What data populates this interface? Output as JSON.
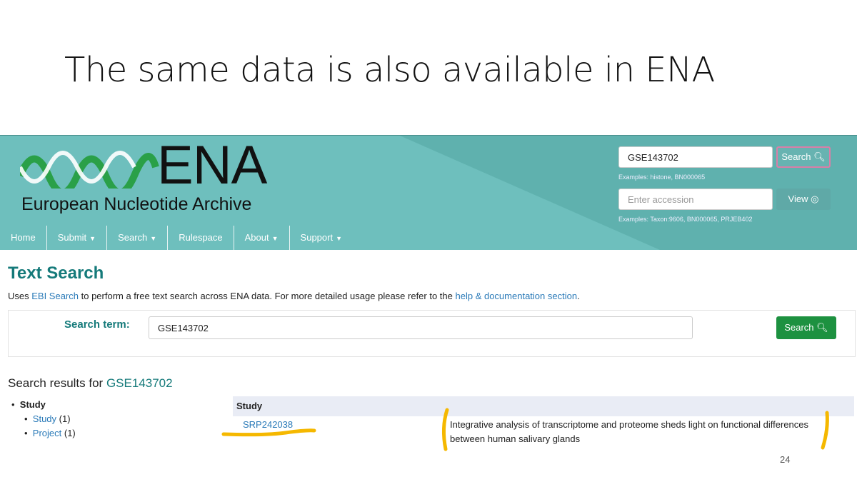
{
  "slide": {
    "title": "The same data is also available in ENA",
    "page_number": "24"
  },
  "header": {
    "logo_text": "ENA",
    "logo_subtitle": "European Nucleotide Archive",
    "search": {
      "value": "GSE143702",
      "button": "Search",
      "hint": "Examples: histone, BN000065"
    },
    "accession": {
      "placeholder": "Enter accession",
      "button": "View",
      "hint": "Examples: Taxon:9606, BN000065, PRJEB402"
    }
  },
  "nav": {
    "items": [
      {
        "label": "Home"
      },
      {
        "label": "Submit"
      },
      {
        "label": "Search"
      },
      {
        "label": "Rulespace"
      },
      {
        "label": "About"
      },
      {
        "label": "Support"
      }
    ]
  },
  "main": {
    "title": "Text Search",
    "uses_prefix": "Uses ",
    "uses_link": "EBI Search",
    "uses_middle": " to perform a free text search across ENA data. For more detailed usage please refer to the ",
    "uses_link2": "help & documentation section",
    "uses_suffix": ".",
    "search_label": "Search term:",
    "search_value": "GSE143702",
    "search_button": "Search",
    "results_prefix": "Search results for ",
    "results_term": "GSE143702"
  },
  "facets": {
    "group": "Study",
    "items": [
      {
        "label": "Study",
        "count": "(1)"
      },
      {
        "label": "Project",
        "count": "(1)"
      }
    ]
  },
  "results": {
    "header": "Study",
    "rows": [
      {
        "accession": "SRP242038",
        "description": "Integrative analysis of transcriptome and proteome sheds light on functional differences between human salivary glands"
      }
    ]
  },
  "colors": {
    "banner": "#6ebfbd",
    "accent": "#157a7a",
    "link": "#2a7ab8",
    "button_green": "#1d9140",
    "highlight": "#f5b800"
  }
}
